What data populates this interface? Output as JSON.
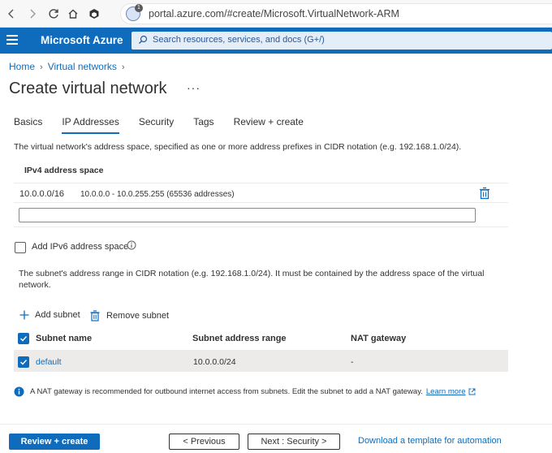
{
  "browser": {
    "url": "portal.azure.com/#create/Microsoft.VirtualNetwork-ARM",
    "badge": "1"
  },
  "header": {
    "brand": "Microsoft Azure",
    "search_placeholder": "Search resources, services, and docs (G+/)"
  },
  "breadcrumb": [
    "Home",
    "Virtual networks"
  ],
  "page": {
    "title": "Create virtual network",
    "more": "···"
  },
  "tabs": [
    {
      "label": "Basics",
      "active": false
    },
    {
      "label": "IP Addresses",
      "active": true
    },
    {
      "label": "Security",
      "active": false
    },
    {
      "label": "Tags",
      "active": false
    },
    {
      "label": "Review + create",
      "active": false
    }
  ],
  "ip": {
    "description": "The virtual network's address space, specified as one or more address prefixes in CIDR notation (e.g. 192.168.1.0/24).",
    "ipv4_header": "IPv4 address space",
    "entries": [
      {
        "cidr": "10.0.0.0/16",
        "range": "10.0.0.0 - 10.0.255.255 (65536 addresses)"
      }
    ],
    "new_value": "",
    "ipv6_label": "Add IPv6 address space",
    "ipv6_checked": false
  },
  "subnets": {
    "description": "The subnet's address range in CIDR notation (e.g. 192.168.1.0/24). It must be contained by the address space of the virtual network.",
    "add_label": "Add subnet",
    "remove_label": "Remove subnet",
    "columns": [
      "Subnet name",
      "Subnet address range",
      "NAT gateway"
    ],
    "rows": [
      {
        "name": "default",
        "range": "10.0.0.0/24",
        "nat": "-",
        "selected": true
      }
    ]
  },
  "nat_info": {
    "text": "A NAT gateway is recommended for outbound internet access from subnets. Edit the subnet to add a NAT gateway.",
    "link": "Learn more"
  },
  "footer": {
    "review_create": "Review + create",
    "previous": "< Previous",
    "next": "Next : Security >",
    "download": "Download a template for automation"
  },
  "colors": {
    "accent": "#0f6cbd",
    "text": "#323130"
  }
}
